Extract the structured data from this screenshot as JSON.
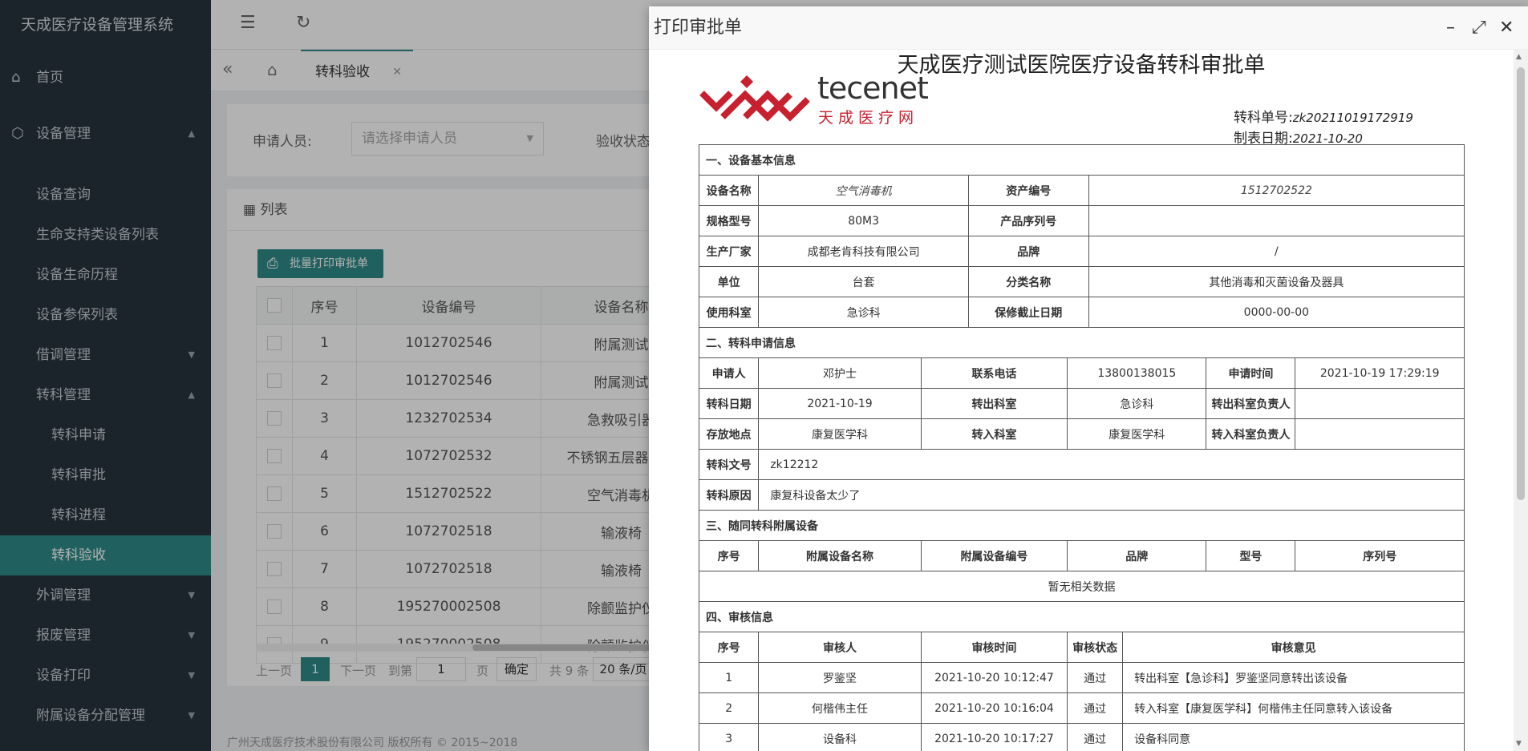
{
  "sidebar": {
    "brand": "天成医疗设备管理系统",
    "home": "首页",
    "device_mgmt": "设备管理",
    "items": [
      "设备查询",
      "生命支持类设备列表",
      "设备生命历程",
      "设备参保列表"
    ],
    "borrow_mgmt": "借调管理",
    "transfer_mgmt": "转科管理",
    "transfer_sub": [
      "转科申请",
      "转科审批",
      "转科进程",
      "转科验收"
    ],
    "bottom_items": [
      "外调管理",
      "报废管理",
      "设备打印",
      "附属设备分配管理"
    ]
  },
  "tabs": {
    "active": "转科验收"
  },
  "filter": {
    "applicant_label": "申请人员:",
    "applicant_placeholder": "请选择申请人员",
    "status_label": "验收状态:"
  },
  "list": {
    "title": "列表",
    "batch_print": "批量打印审批单",
    "columns": [
      "序号",
      "设备编号",
      "设备名称"
    ],
    "rows": [
      [
        "1",
        "1012702546",
        "附属测试"
      ],
      [
        "2",
        "1012702546",
        "附属测试"
      ],
      [
        "3",
        "1232702534",
        "急救吸引器"
      ],
      [
        "4",
        "1072702532",
        "不锈钢五层器械柜"
      ],
      [
        "5",
        "1512702522",
        "空气消毒机"
      ],
      [
        "6",
        "1072702518",
        "输液椅"
      ],
      [
        "7",
        "1072702518",
        "输液椅"
      ],
      [
        "8",
        "195270002508",
        "除颤监护仪"
      ],
      [
        "9",
        "195270002508",
        "除颤监护仪"
      ]
    ],
    "pager": {
      "prev": "上一页",
      "page": "1",
      "next": "下一页",
      "goto": "到第",
      "goto_value": "1",
      "page_unit": "页",
      "confirm": "确定",
      "total": "共 9 条",
      "size": "20 条/页"
    }
  },
  "footer": "广州天成医疗技术股份有限公司 版权所有 © 2015~2018",
  "modal": {
    "title": "打印审批单",
    "doc_title": "天成医疗测试医院医疗设备转科审批单",
    "logo_text": "tecenet",
    "logo_sub": "天成医疗网",
    "order_label": "转科单号:",
    "order_no": "zk20211019172919",
    "date_label": "制表日期:",
    "date": "2021-10-20",
    "s1": "一、设备基本信息",
    "s1_rows": [
      [
        "设备名称",
        "空气消毒机",
        "资产编号",
        "1512702522"
      ],
      [
        "规格型号",
        "80M3",
        "产品序列号",
        ""
      ],
      [
        "生产厂家",
        "成都老肯科技有限公司",
        "品牌",
        "/"
      ],
      [
        "单位",
        "台套",
        "分类名称",
        "其他消毒和灭菌设备及器具"
      ],
      [
        "使用科室",
        "急诊科",
        "保修截止日期",
        "0000-00-00"
      ]
    ],
    "s2": "二、转科申请信息",
    "s2_rows": [
      [
        "申请人",
        "邓护士",
        "联系电话",
        "13800138015",
        "申请时间",
        "2021-10-19 17:29:19"
      ],
      [
        "转科日期",
        "2021-10-19",
        "转出科室",
        "急诊科",
        "转出科室负责人",
        ""
      ],
      [
        "存放地点",
        "康复医学科",
        "转入科室",
        "康复医学科",
        "转入科室负责人",
        ""
      ]
    ],
    "doc_no_label": "转科文号",
    "doc_no": "zk12212",
    "reason_label": "转科原因",
    "reason": "康复科设备太少了",
    "s3": "三、随同转科附属设备",
    "s3_cols": [
      "序号",
      "附属设备名称",
      "附属设备编号",
      "品牌",
      "型号",
      "序列号"
    ],
    "s3_empty": "暂无相关数据",
    "s4": "四、审核信息",
    "s4_cols": [
      "序号",
      "审核人",
      "审核时间",
      "审核状态",
      "审核意见"
    ],
    "s4_rows": [
      [
        "1",
        "罗鉴坚",
        "2021-10-20 10:12:47",
        "通过",
        "转出科室【急诊科】罗鉴坚同意转出该设备"
      ],
      [
        "2",
        "何楷伟主任",
        "2021-10-20 10:16:04",
        "通过",
        "转入科室【康复医学科】何楷伟主任同意转入该设备"
      ],
      [
        "3",
        "设备科",
        "2021-10-20 10:17:27",
        "通过",
        "设备科同意"
      ]
    ]
  }
}
